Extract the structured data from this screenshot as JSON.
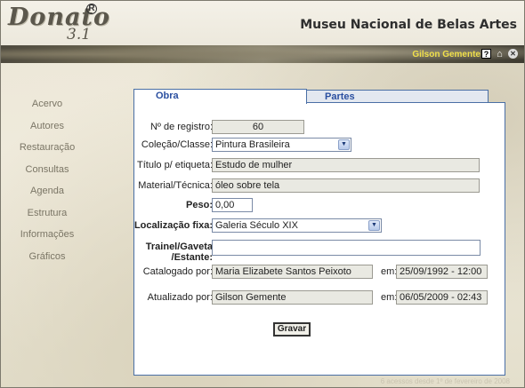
{
  "app": {
    "logo_word": "Donato",
    "logo_version": "3.1",
    "logo_reg": "R",
    "museum_title": "Museu Nacional de Belas Artes"
  },
  "topbar": {
    "user_name": "Gilson Gemente",
    "help_glyph": "?",
    "home_glyph": "⌂",
    "close_glyph": "✕"
  },
  "sidebar": {
    "items": [
      {
        "label": "Acervo"
      },
      {
        "label": "Autores"
      },
      {
        "label": "Restauração"
      },
      {
        "label": "Consultas"
      },
      {
        "label": "Agenda"
      },
      {
        "label": "Estrutura"
      },
      {
        "label": "Informações"
      },
      {
        "label": "Gráficos"
      }
    ]
  },
  "tabs": [
    {
      "label": "Obra",
      "active": true
    },
    {
      "label": "Partes",
      "active": false
    }
  ],
  "form": {
    "registro": {
      "label": "Nº de registro:",
      "value": "60"
    },
    "colecao": {
      "label": "Coleção/Classe:",
      "value": "Pintura Brasileira"
    },
    "titulo": {
      "label": "Título p/ etiqueta:",
      "value": "Estudo de mulher"
    },
    "material": {
      "label": "Material/Técnica:",
      "value": "óleo sobre tela"
    },
    "peso": {
      "label": "Peso:",
      "value": "0,00"
    },
    "localizacao": {
      "label": "Localização fixa:",
      "value": "Galeria Século XIX"
    },
    "trainel": {
      "label_line1": "Trainel/Gaveta",
      "label_line2": "/Estante:",
      "value": ""
    },
    "catalogado": {
      "label": "Catalogado por:",
      "value": "Maria Elizabete Santos Peixoto",
      "em_label": "em:",
      "date": "25/09/1992 - 12:00"
    },
    "atualizado": {
      "label": "Atualizado por:",
      "value": "Gilson Gemente",
      "em_label": "em:",
      "date": "06/05/2009 - 02:43"
    },
    "save_label": "Gravar"
  },
  "footer": {
    "text": "6 acessos desde 1º de fevereiro de 2008"
  },
  "colors": {
    "accent_blue": "#2a4fa0",
    "panel_border": "#4a6fa5",
    "user_yellow": "#f1e04a"
  }
}
